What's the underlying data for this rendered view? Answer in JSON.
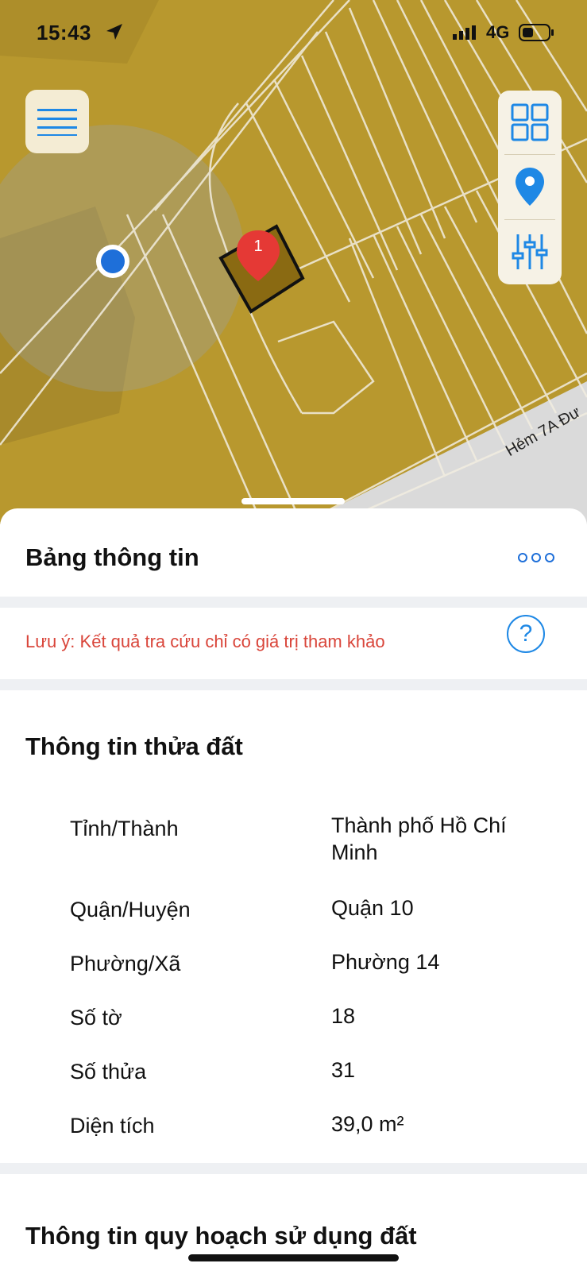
{
  "status_bar": {
    "time": "15:43",
    "network": "4G"
  },
  "map": {
    "parcel_marker_number": "1",
    "street_label": "Hẻm 7A Đư"
  },
  "panel": {
    "title": "Bảng thông tin",
    "note": "Lưu ý: Kết quả tra cứu chỉ có giá trị tham khảo",
    "help_label": "?",
    "land_section": {
      "title": "Thông tin thửa đất",
      "rows": [
        {
          "label": "Tỉnh/Thành",
          "value": "Thành phố Hồ Chí Minh"
        },
        {
          "label": "Quận/Huyện",
          "value": "Quận 10"
        },
        {
          "label": "Phường/Xã",
          "value": "Phường 14"
        },
        {
          "label": "Số tờ",
          "value": "18"
        },
        {
          "label": "Số thửa",
          "value": "31"
        },
        {
          "label": "Diện tích",
          "value": "39,0 m²"
        }
      ]
    },
    "planning_section": {
      "title": "Thông tin quy hoạch sử dụng đất"
    }
  },
  "colors": {
    "accent": "#1e88e5",
    "map_fill": "#b8982e",
    "marker": "#e53935",
    "warning_text": "#d9453a"
  },
  "icons": [
    "location-arrow-icon",
    "signal-icon",
    "battery-icon",
    "hamburger-menu-icon",
    "grid-layers-icon",
    "location-pin-icon",
    "sliders-icon",
    "more-icon",
    "help-icon",
    "map-marker-icon"
  ]
}
